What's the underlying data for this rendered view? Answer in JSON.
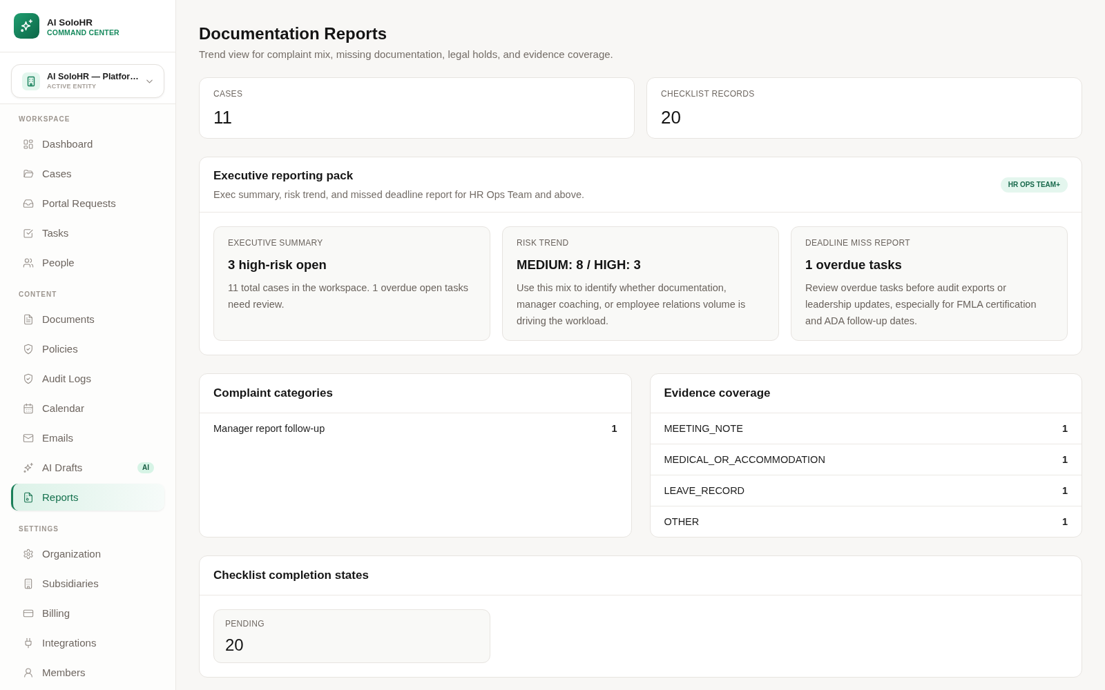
{
  "sidebar": {
    "brand": {
      "name": "AI SoloHR",
      "tagline": "COMMAND CENTER"
    },
    "entity": {
      "name": "AI SoloHR — Platfor…",
      "caption": "ACTIVE ENTITY"
    },
    "sections": [
      {
        "label": "WORKSPACE",
        "items": [
          {
            "label": "Dashboard",
            "selected": false
          },
          {
            "label": "Cases",
            "selected": false
          },
          {
            "label": "Portal Requests",
            "selected": false
          },
          {
            "label": "Tasks",
            "selected": false
          },
          {
            "label": "People",
            "selected": false
          }
        ]
      },
      {
        "label": "CONTENT",
        "items": [
          {
            "label": "Documents",
            "selected": false
          },
          {
            "label": "Policies",
            "selected": false
          },
          {
            "label": "Audit Logs",
            "selected": false
          },
          {
            "label": "Calendar",
            "selected": false
          },
          {
            "label": "Emails",
            "selected": false
          },
          {
            "label": "AI Drafts",
            "selected": false,
            "badge": "AI"
          },
          {
            "label": "Reports",
            "selected": true
          }
        ]
      },
      {
        "label": "SETTINGS",
        "items": [
          {
            "label": "Organization",
            "selected": false
          },
          {
            "label": "Subsidiaries",
            "selected": false
          },
          {
            "label": "Billing",
            "selected": false
          },
          {
            "label": "Integrations",
            "selected": false
          },
          {
            "label": "Members",
            "selected": false
          }
        ]
      }
    ]
  },
  "header": {
    "title": "Documentation Reports",
    "subtitle": "Trend view for complaint mix, missing documentation, legal holds, and evidence coverage."
  },
  "stats": [
    {
      "label": "CASES",
      "value": "11"
    },
    {
      "label": "CHECKLIST RECORDS",
      "value": "20"
    }
  ],
  "executive_pack": {
    "title": "Executive reporting pack",
    "subtitle": "Exec summary, risk trend, and missed deadline report for HR Ops Team and above.",
    "badge": "HR OPS TEAM+",
    "cards": [
      {
        "label": "EXECUTIVE SUMMARY",
        "headline": "3 high-risk open",
        "body": "11 total cases in the workspace. 1 overdue open tasks need review."
      },
      {
        "label": "RISK TREND",
        "headline": "MEDIUM: 8 / HIGH: 3",
        "body": "Use this mix to identify whether documentation, manager coaching, or employee relations volume is driving the workload."
      },
      {
        "label": "DEADLINE MISS REPORT",
        "headline": "1 overdue tasks",
        "body": "Review overdue tasks before audit exports or leadership updates, especially for FMLA certification and ADA follow-up dates."
      }
    ]
  },
  "complaint_categories": {
    "title": "Complaint categories",
    "rows": [
      {
        "label": "Manager report follow-up",
        "count": "1"
      }
    ]
  },
  "evidence_coverage": {
    "title": "Evidence coverage",
    "rows": [
      {
        "label": "MEETING_NOTE",
        "count": "1"
      },
      {
        "label": "MEDICAL_OR_ACCOMMODATION",
        "count": "1"
      },
      {
        "label": "LEAVE_RECORD",
        "count": "1"
      },
      {
        "label": "OTHER",
        "count": "1"
      }
    ]
  },
  "checklist_states": {
    "title": "Checklist completion states",
    "items": [
      {
        "label": "PENDING",
        "value": "20"
      }
    ]
  }
}
